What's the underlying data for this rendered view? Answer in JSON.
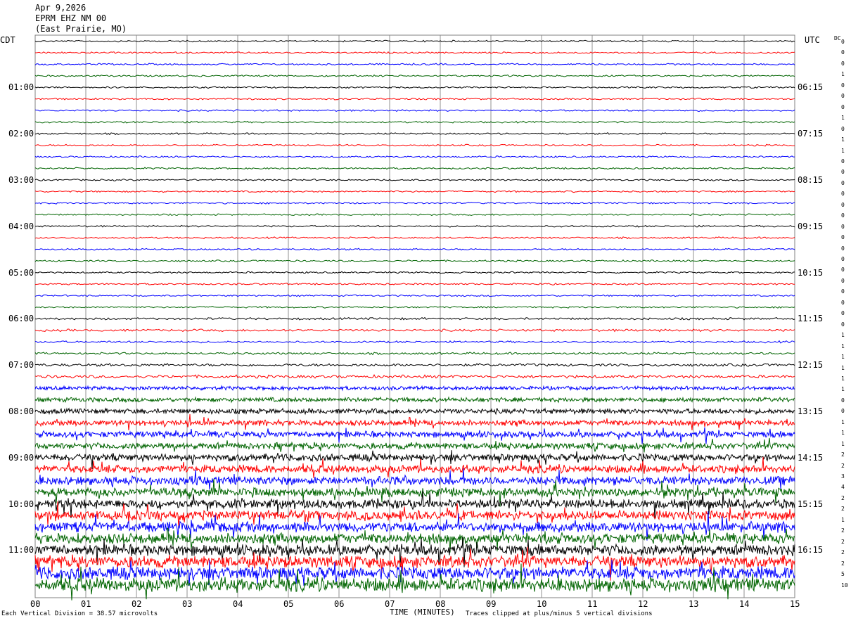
{
  "header": {
    "date": "Apr 9,2026",
    "station": "EPRM EHZ NM 00",
    "location": "(East Prairie, MO)"
  },
  "left_timezone": "CDT",
  "right_timezone": "UTC",
  "dc_header": "DC",
  "footer": {
    "scale_note": "Each Vertical Division = 38.57 microvolts",
    "x_title": "TIME (MINUTES)",
    "clip_note": "Traces clipped at plus/minus 5 vertical divisions"
  },
  "colors": [
    "#000000",
    "#ff0000",
    "#0000ff",
    "#006400"
  ],
  "chart_data": {
    "type": "line",
    "title": "EPRM EHZ NM 00",
    "xlabel": "TIME (MINUTES)",
    "x_ticks": [
      "00",
      "01",
      "02",
      "03",
      "04",
      "05",
      "06",
      "07",
      "08",
      "09",
      "10",
      "11",
      "12",
      "13",
      "14",
      "15"
    ],
    "xlim": [
      0,
      15
    ],
    "left_hour_labels": [
      "01:00",
      "02:00",
      "03:00",
      "04:00",
      "05:00",
      "06:00",
      "07:00",
      "08:00",
      "09:00",
      "10:00",
      "11:00"
    ],
    "right_hour_labels": [
      "06:15",
      "07:15",
      "08:15",
      "09:15",
      "10:15",
      "11:15",
      "12:15",
      "13:15",
      "14:15",
      "15:15",
      "16:15"
    ],
    "trace_count": 48,
    "dc_offsets": [
      "0",
      "0",
      "0",
      "1",
      "0",
      "0",
      "0",
      "1",
      "0",
      "1",
      "1",
      "0",
      "0",
      "0",
      "0",
      "0",
      "0",
      "0",
      "0",
      "0",
      "0",
      "0",
      "0",
      "0",
      "0",
      "0",
      "0",
      "1",
      "1",
      "1",
      "1",
      "1",
      "1",
      "0",
      "0",
      "1",
      "1",
      "1",
      "2",
      "2",
      "3",
      "4",
      "2",
      "2",
      "1",
      "2",
      "2",
      "2",
      "2",
      "5",
      "10"
    ],
    "amplitude_levels": [
      1,
      1,
      1,
      1,
      1,
      1,
      1,
      1,
      1,
      1,
      1,
      1,
      1,
      1,
      1,
      1,
      1,
      1,
      1,
      1,
      1,
      1,
      1,
      1,
      1.3,
      1.4,
      1.2,
      1.3,
      1.6,
      1.8,
      2.2,
      2.6,
      3,
      3.2,
      3.6,
      3.8,
      4.2,
      4.6,
      5,
      5.2,
      5.4,
      5.6,
      5.8,
      6,
      6.5,
      7,
      7.5,
      8
    ]
  }
}
